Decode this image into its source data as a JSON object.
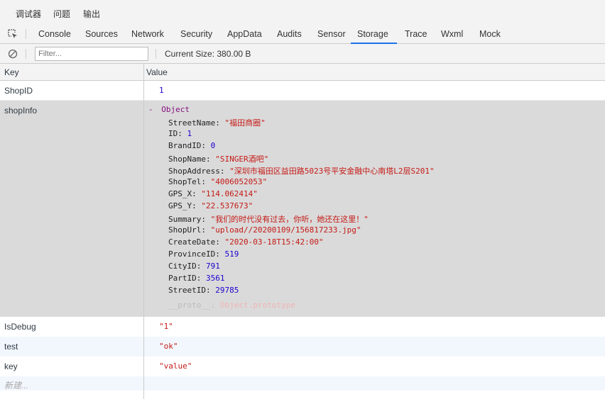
{
  "top_tabs": [
    "调试器",
    "问题",
    "输出"
  ],
  "panel_tabs": [
    "Console",
    "Sources",
    "Network",
    "Security",
    "AppData",
    "Audits",
    "Sensor",
    "Storage",
    "Trace",
    "Wxml",
    "Mock"
  ],
  "active_panel_tab": "Storage",
  "toolbar": {
    "filter_placeholder": "Filter...",
    "current_size": "Current Size:  380.00 B"
  },
  "columns": {
    "key": "Key",
    "value": "Value"
  },
  "rows": {
    "shopid": {
      "key": "ShopID",
      "value": "1"
    },
    "shopinfo": {
      "key": "shopInfo",
      "header_toggle": "-",
      "header_type": "Object",
      "fields": [
        {
          "name": "StreetName",
          "value": "\"福田商圈\""
        },
        {
          "name": "ID",
          "value": "1"
        },
        {
          "name": "BrandID",
          "value": "0"
        },
        {
          "name": "ShopName",
          "value": "\"SINGER酒吧\""
        },
        {
          "name": "ShopAddress",
          "value": "\"深圳市福田区益田路5023号平安金融中心南塔L2层S201\""
        },
        {
          "name": "ShopTel",
          "value": "\"4006052053\""
        },
        {
          "name": "GPS_X",
          "value": "\"114.062414\""
        },
        {
          "name": "GPS_Y",
          "value": "\"22.537673\""
        },
        {
          "name": "Summary",
          "value": "\"我们的时代没有过去，你听，她还在这里！\""
        },
        {
          "name": "ShopUrl",
          "value": "\"upload//20200109/156817233.jpg\""
        },
        {
          "name": "CreateDate",
          "value": "\"2020-03-18T15:42:00\""
        },
        {
          "name": "ProvinceID",
          "value": "519"
        },
        {
          "name": "CityID",
          "value": "791"
        },
        {
          "name": "PartID",
          "value": "3561"
        },
        {
          "name": "StreetID",
          "value": "29785"
        }
      ],
      "proto_name": "__proto__",
      "proto_value": "Object.prototype"
    },
    "isdebug": {
      "key": "IsDebug",
      "value": "\"1\""
    },
    "test": {
      "key": "test",
      "value": "\"ok\""
    },
    "key": {
      "key": "key",
      "value": "\"value\""
    },
    "new_placeholder": "新建..."
  },
  "colors": {
    "accent": "#1a73e8",
    "number": "#1c00cf",
    "string": "#c41a16",
    "object": "#881280"
  }
}
